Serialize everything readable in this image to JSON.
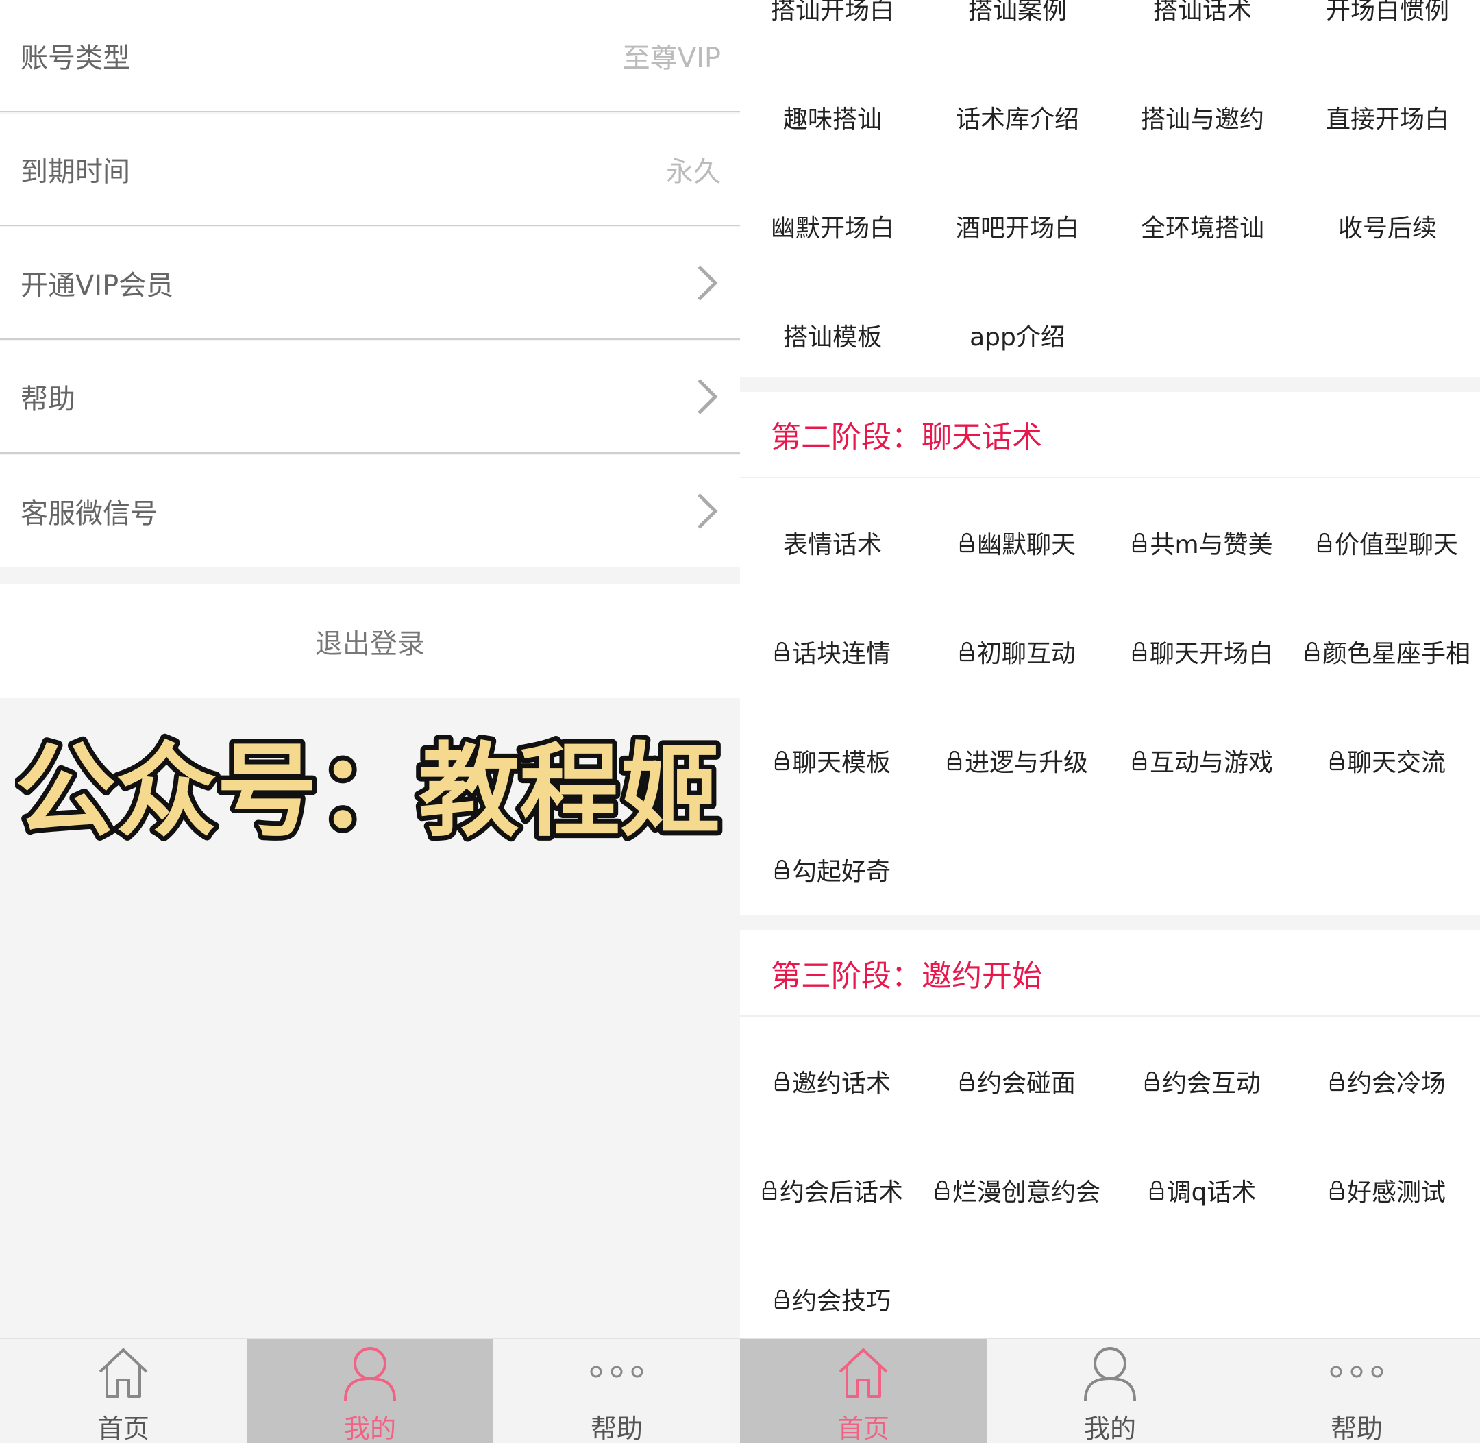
{
  "profile": {
    "rows": [
      {
        "label": "账号类型",
        "value": "至尊VIP"
      },
      {
        "label": "到期时间",
        "value": "永久"
      },
      {
        "label": "开通VIP会员",
        "icon": "chevron-right-icon"
      },
      {
        "label": "帮助",
        "icon": "chevron-right-icon"
      },
      {
        "label": "客服微信号",
        "icon": "chevron-right-icon"
      }
    ],
    "logout_label": "退出登录",
    "watermark": "公众号：教程姬"
  },
  "home": {
    "stage1_items": [
      "搭讪开场白",
      "搭讪案例",
      "搭讪话术",
      "开场白惯例",
      "趣味搭讪",
      "话术库介绍",
      "搭讪与邀约",
      "直接开场白",
      "幽默开场白",
      "酒吧开场白",
      "全环境搭讪",
      "收号后续",
      "搭讪模板",
      "app介绍"
    ],
    "stage2_title": "第二阶段：聊天话术",
    "stage2_items": [
      {
        "label": "表情话术",
        "locked": false
      },
      {
        "label": "幽默聊天",
        "locked": true
      },
      {
        "label": "共m与赞美",
        "locked": true
      },
      {
        "label": "价值型聊天",
        "locked": true
      },
      {
        "label": "话块连情",
        "locked": true
      },
      {
        "label": "初聊互动",
        "locked": true
      },
      {
        "label": "聊天开场白",
        "locked": true
      },
      {
        "label": "颜色星座手相",
        "locked": true
      },
      {
        "label": "聊天模板",
        "locked": true
      },
      {
        "label": "进逻与升级",
        "locked": true
      },
      {
        "label": "互动与游戏",
        "locked": true
      },
      {
        "label": "聊天交流",
        "locked": true
      },
      {
        "label": "勾起好奇",
        "locked": true
      }
    ],
    "stage3_title": "第三阶段：邀约开始",
    "stage3_items": [
      {
        "label": "邀约话术",
        "locked": true
      },
      {
        "label": "约会碰面",
        "locked": true
      },
      {
        "label": "约会互动",
        "locked": true
      },
      {
        "label": "约会冷场",
        "locked": true
      },
      {
        "label": "约会后话术",
        "locked": true
      },
      {
        "label": "烂漫创意约会",
        "locked": true
      },
      {
        "label": "调q话术",
        "locked": true
      },
      {
        "label": "好感测试",
        "locked": true
      },
      {
        "label": "约会技巧",
        "locked": true
      }
    ]
  },
  "tabs": [
    {
      "label": "首页",
      "icon": "home-icon"
    },
    {
      "label": "我的",
      "icon": "user-icon"
    },
    {
      "label": "帮助",
      "icon": "more-dots-icon"
    }
  ],
  "colors": {
    "accent": "#e8184d",
    "tab_active_label": "#f06385",
    "tab_active_bg": "#c3c3c3",
    "watermark_fill": "#f5d98f"
  }
}
